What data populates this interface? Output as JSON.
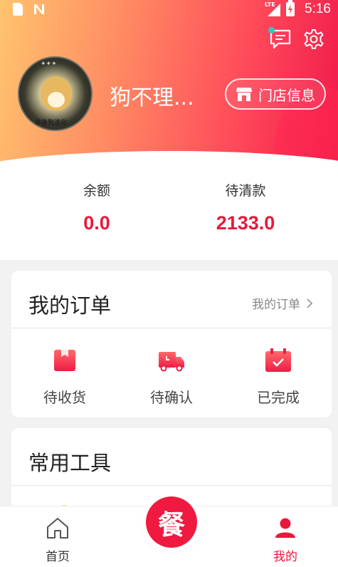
{
  "status_bar": {
    "time": "5:16",
    "network": "LTE",
    "icons": [
      "sim-icon",
      "n-icon",
      "signal-icon",
      "battery-icon"
    ]
  },
  "header": {
    "username": "狗不理...",
    "store_button_label": "门店信息",
    "avatar_caption": "单身狗进化",
    "icons": [
      "message-icon",
      "gear-icon",
      "store-icon"
    ]
  },
  "balance": {
    "left_label": "余额",
    "left_value": "0.0",
    "right_label": "待清款",
    "right_value": "2133.0",
    "value_color": "#e8183a"
  },
  "orders": {
    "title": "我的订单",
    "more_label": "我的订单",
    "items": [
      {
        "label": "待收货",
        "icon": "package-icon"
      },
      {
        "label": "待确认",
        "icon": "truck-icon"
      },
      {
        "label": "已完成",
        "icon": "calendar-check-icon"
      }
    ]
  },
  "tools": {
    "title": "常用工具"
  },
  "bottom_nav": {
    "home_label": "首页",
    "center_label": "餐",
    "mine_label": "我的",
    "active": "mine",
    "accent": "#e8183a"
  }
}
